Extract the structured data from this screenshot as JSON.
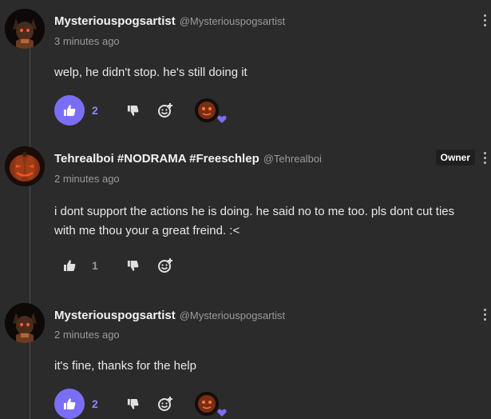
{
  "colors": {
    "background": "#2b2b2b",
    "accent": "#7b6ef6",
    "accent_text": "#8f86ff",
    "heart": "#7b6ef6"
  },
  "comments": [
    {
      "username": "Mysteriouspogsartist",
      "handle": "@Mysteriouspogsartist",
      "timestamp": "3 minutes ago",
      "text": "welp, he didn't stop. he's still doing it",
      "likes": "2",
      "liked": true,
      "avatar_icon": "mysterious-avatar",
      "reaction_icon": "heart-reaction-icon"
    },
    {
      "username": "Tehrealboi #NODRAMA #Freeschlep",
      "handle": "@Tehrealboi",
      "badge": "Owner",
      "timestamp": "2 minutes ago",
      "text": "i dont support the actions he is doing. he said no to me too. pls dont cut ties with me thou your a great freind. :<",
      "likes": "1",
      "liked": false,
      "avatar_icon": "pumpkin-avatar"
    },
    {
      "username": "Mysteriouspogsartist",
      "handle": "@Mysteriouspogsartist",
      "timestamp": "2 minutes ago",
      "text": "it's fine, thanks for the help",
      "likes": "2",
      "liked": true,
      "avatar_icon": "mysterious-avatar",
      "reaction_icon": "heart-reaction-icon"
    }
  ]
}
